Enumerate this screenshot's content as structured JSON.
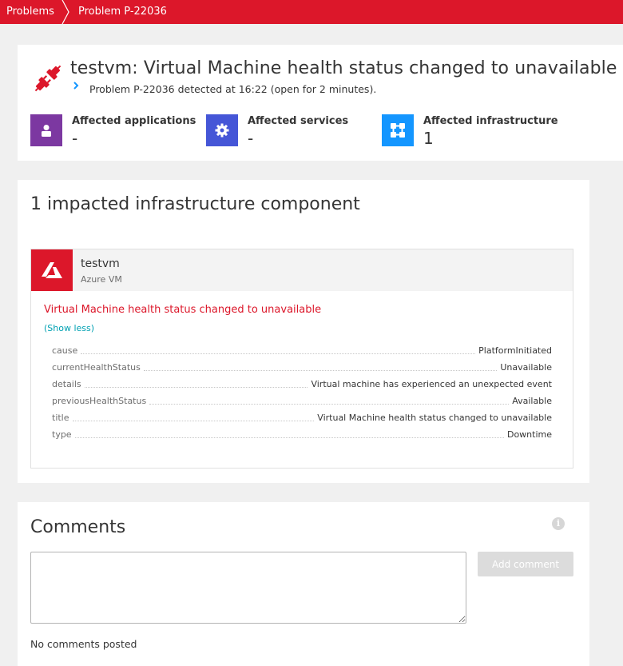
{
  "breadcrumb": {
    "items": [
      "Problems",
      "Problem P-22036"
    ]
  },
  "header": {
    "title": "testvm: Virtual Machine health status changed to unavailable",
    "subtitle": "Problem P-22036 detected at 16:22 (open for 2 minutes).",
    "affected": {
      "applications": {
        "label": "Affected applications",
        "value": "-"
      },
      "services": {
        "label": "Affected services",
        "value": "-"
      },
      "infrastructure": {
        "label": "Affected infrastructure",
        "value": "1"
      }
    }
  },
  "impact": {
    "title": "1 impacted infrastructure component",
    "component": {
      "name": "testvm",
      "type": "Azure VM",
      "event_title": "Virtual Machine health status changed to unavailable",
      "show_less": "(Show less)",
      "properties": [
        {
          "key": "cause",
          "value": "PlatformInitiated"
        },
        {
          "key": "currentHealthStatus",
          "value": "Unavailable"
        },
        {
          "key": "details",
          "value": "Virtual machine has experienced an unexpected event"
        },
        {
          "key": "previousHealthStatus",
          "value": "Available"
        },
        {
          "key": "title",
          "value": "Virtual Machine health status changed to unavailable"
        },
        {
          "key": "type",
          "value": "Downtime"
        }
      ]
    }
  },
  "comments": {
    "title": "Comments",
    "info_icon": "i",
    "textarea_value": "",
    "add_button": "Add comment",
    "empty_text": "No comments posted"
  },
  "colors": {
    "brand_red": "#dc172a",
    "apps_tile": "#7c38a1",
    "services_tile": "#4556d7",
    "infra_tile": "#1496ff",
    "link": "#00a1b2"
  }
}
